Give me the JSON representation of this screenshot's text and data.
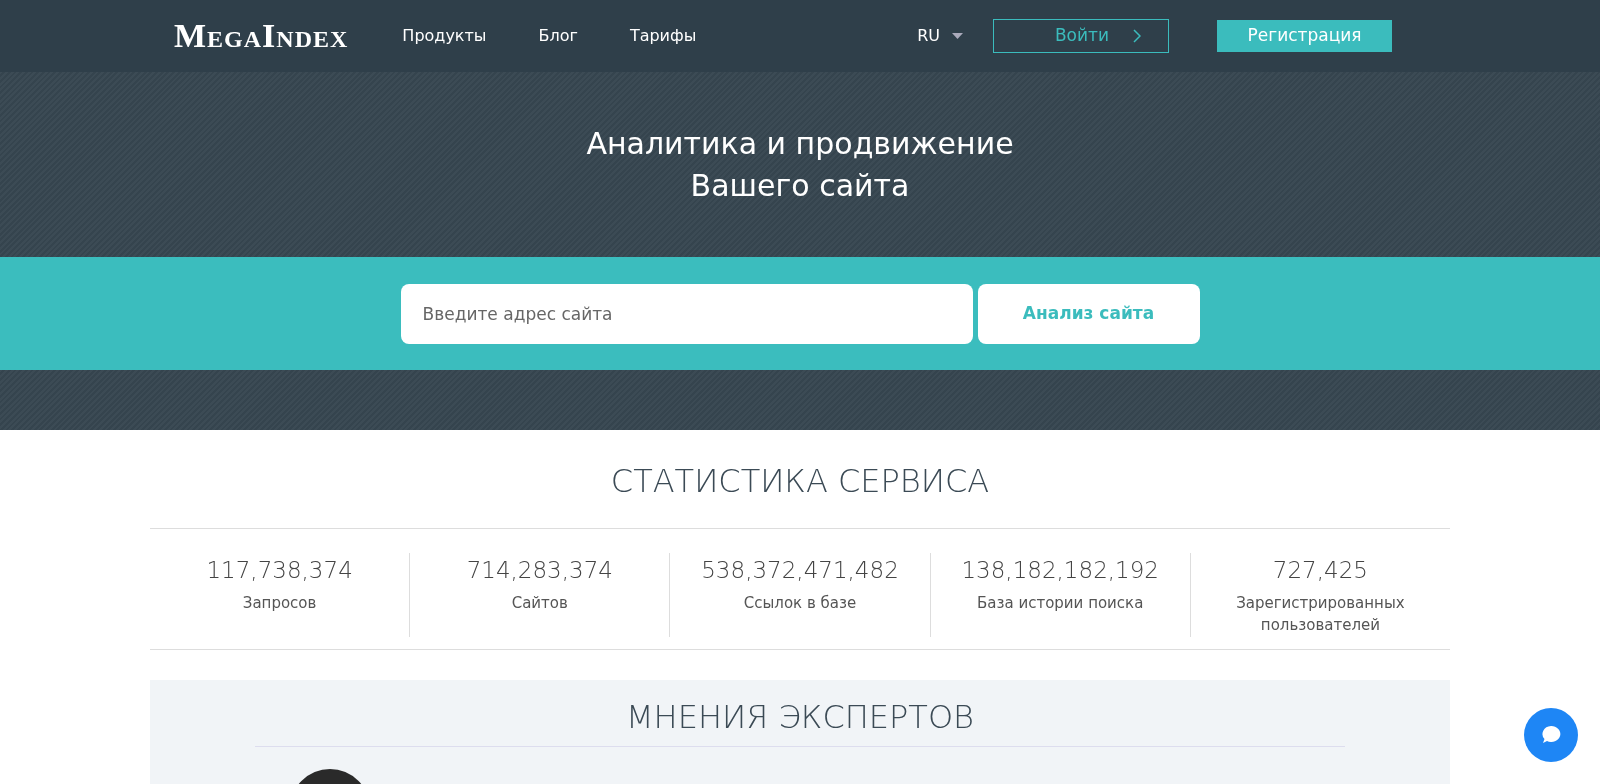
{
  "header": {
    "logo": "MegaIndex",
    "nav": [
      {
        "label": "Продукты"
      },
      {
        "label": "Блог"
      },
      {
        "label": "Тарифы"
      }
    ],
    "language": "RU",
    "login": "Войти",
    "register": "Регистрация"
  },
  "hero": {
    "title_lines": [
      "Аналитика и продвижение",
      "Вашего сайта"
    ]
  },
  "search": {
    "placeholder": "Введите адрес сайта",
    "button": "Анализ сайта"
  },
  "stats": {
    "title": "СТАТИСТИКА СЕРВИСА",
    "items": [
      {
        "value": "117,738,374",
        "label": "Запросов"
      },
      {
        "value": "714,283,374",
        "label": "Сайтов"
      },
      {
        "value": "538,372,471,482",
        "label": "Ссылок в базе"
      },
      {
        "value": "138,182,182,192",
        "label": "База истории поиска"
      },
      {
        "value": "727,425",
        "label": "Зарегистрированных пользователей"
      }
    ]
  },
  "experts": {
    "title": "МНЕНИЯ ЭКСПЕРТОВ"
  }
}
